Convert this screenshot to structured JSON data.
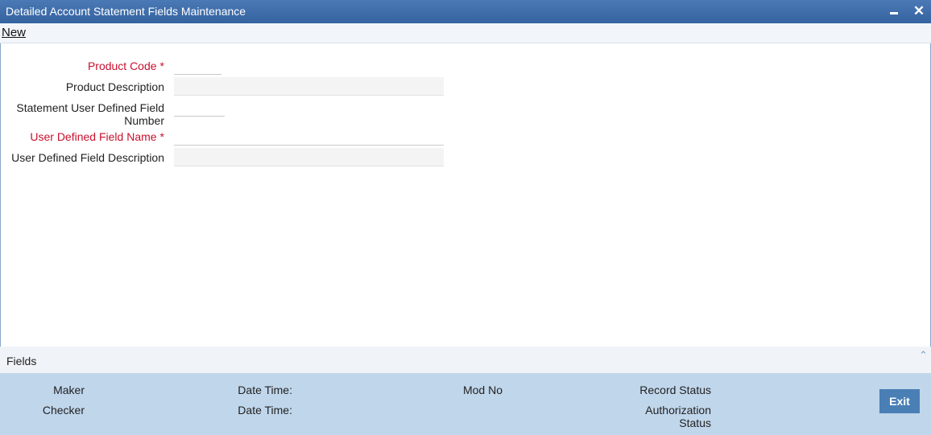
{
  "window": {
    "title": "Detailed Account Statement Fields Maintenance",
    "minimize_label": "",
    "close_label": "✕"
  },
  "toolbar": {
    "new_label": "New"
  },
  "form": {
    "product_code": {
      "label": "Product Code",
      "required": "*",
      "value": ""
    },
    "product_description": {
      "label": "Product Description",
      "value": ""
    },
    "stmt_udf_number": {
      "label_line1": "Statement User Defined Field",
      "label_line2": "Number",
      "value": ""
    },
    "udf_name": {
      "label": "User Defined Field Name",
      "required": "*",
      "value": ""
    },
    "udf_description": {
      "label": "User Defined Field Description",
      "value": ""
    }
  },
  "fields_section": {
    "label": "Fields",
    "collapse_icon": "chevron-up-icon"
  },
  "audit": {
    "maker": "Maker",
    "checker": "Checker",
    "date_time_1": "Date Time:",
    "date_time_2": "Date Time:",
    "mod_no": "Mod No",
    "record_status": "Record Status",
    "authorization_line1": "Authorization",
    "authorization_line2": "Status"
  },
  "buttons": {
    "exit": "Exit"
  },
  "colors": {
    "titlebar": "#3d6ca8",
    "footer": "#c0d6eb",
    "required": "#c8102e",
    "exit_button": "#4a7fb5"
  }
}
